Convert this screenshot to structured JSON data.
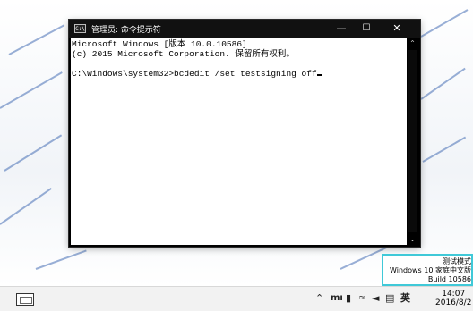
{
  "window": {
    "title": "管理员: 命令提示符",
    "icon_label": "C:\\",
    "minimize_icon": "minimize-icon",
    "maximize_icon": "maximize-icon",
    "close_icon": "close-icon"
  },
  "console": {
    "lines": [
      "Microsoft Windows [版本 10.0.10586]",
      "(c) 2015 Microsoft Corporation. 保留所有权利。",
      "",
      "C:\\Windows\\system32>bcdedit /set testsigning off"
    ]
  },
  "watermark": {
    "line1": "测试模式",
    "line2": "Windows 10 家庭中文版",
    "line3": "Build 10586"
  },
  "taskbar": {
    "tray_icons": [
      "chevron-up-icon",
      "mi-icon",
      "battery-icon",
      "network-icon",
      "volume-icon",
      "action-center-icon"
    ],
    "ime_label": "英",
    "time": "14:07",
    "date": "2016/8/2"
  },
  "colors": {
    "accent_highlight": "#40c9d8",
    "console_bg": "#ffffff",
    "window_frame": "#000000"
  }
}
